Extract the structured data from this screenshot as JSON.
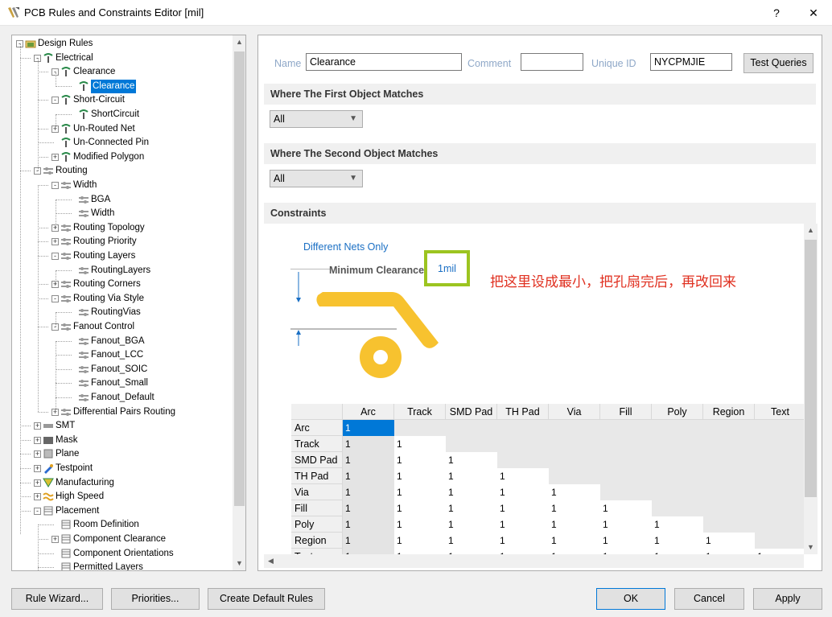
{
  "window": {
    "title": "PCB Rules and Constraints Editor [mil]",
    "help": "?",
    "close": "✕"
  },
  "tree": [
    {
      "label": "Design Rules",
      "depth": 0,
      "exp": "-",
      "icon": "folder"
    },
    {
      "label": "Electrical",
      "depth": 1,
      "exp": "-",
      "icon": "electrical"
    },
    {
      "label": "Clearance",
      "depth": 2,
      "exp": "-",
      "icon": "electrical"
    },
    {
      "label": "Clearance",
      "depth": 3,
      "exp": "",
      "icon": "electrical",
      "selected": true
    },
    {
      "label": "Short-Circuit",
      "depth": 2,
      "exp": "-",
      "icon": "electrical"
    },
    {
      "label": "ShortCircuit",
      "depth": 3,
      "exp": "",
      "icon": "electrical"
    },
    {
      "label": "Un-Routed Net",
      "depth": 2,
      "exp": "+",
      "icon": "electrical"
    },
    {
      "label": "Un-Connected Pin",
      "depth": 2,
      "exp": "",
      "icon": "electrical"
    },
    {
      "label": "Modified Polygon",
      "depth": 2,
      "exp": "+",
      "icon": "electrical"
    },
    {
      "label": "Routing",
      "depth": 1,
      "exp": "-",
      "icon": "routing"
    },
    {
      "label": "Width",
      "depth": 2,
      "exp": "-",
      "icon": "routing"
    },
    {
      "label": "BGA",
      "depth": 3,
      "exp": "",
      "icon": "routing"
    },
    {
      "label": "Width",
      "depth": 3,
      "exp": "",
      "icon": "routing"
    },
    {
      "label": "Routing Topology",
      "depth": 2,
      "exp": "+",
      "icon": "routing"
    },
    {
      "label": "Routing Priority",
      "depth": 2,
      "exp": "+",
      "icon": "routing"
    },
    {
      "label": "Routing Layers",
      "depth": 2,
      "exp": "-",
      "icon": "routing"
    },
    {
      "label": "RoutingLayers",
      "depth": 3,
      "exp": "",
      "icon": "routing"
    },
    {
      "label": "Routing Corners",
      "depth": 2,
      "exp": "+",
      "icon": "routing"
    },
    {
      "label": "Routing Via Style",
      "depth": 2,
      "exp": "-",
      "icon": "routing"
    },
    {
      "label": "RoutingVias",
      "depth": 3,
      "exp": "",
      "icon": "routing"
    },
    {
      "label": "Fanout Control",
      "depth": 2,
      "exp": "-",
      "icon": "routing"
    },
    {
      "label": "Fanout_BGA",
      "depth": 3,
      "exp": "",
      "icon": "routing"
    },
    {
      "label": "Fanout_LCC",
      "depth": 3,
      "exp": "",
      "icon": "routing"
    },
    {
      "label": "Fanout_SOIC",
      "depth": 3,
      "exp": "",
      "icon": "routing"
    },
    {
      "label": "Fanout_Small",
      "depth": 3,
      "exp": "",
      "icon": "routing"
    },
    {
      "label": "Fanout_Default",
      "depth": 3,
      "exp": "",
      "icon": "routing"
    },
    {
      "label": "Differential Pairs Routing",
      "depth": 2,
      "exp": "+",
      "icon": "routing"
    },
    {
      "label": "SMT",
      "depth": 1,
      "exp": "+",
      "icon": "smt"
    },
    {
      "label": "Mask",
      "depth": 1,
      "exp": "+",
      "icon": "mask"
    },
    {
      "label": "Plane",
      "depth": 1,
      "exp": "+",
      "icon": "plane"
    },
    {
      "label": "Testpoint",
      "depth": 1,
      "exp": "+",
      "icon": "testpoint"
    },
    {
      "label": "Manufacturing",
      "depth": 1,
      "exp": "+",
      "icon": "manufacturing"
    },
    {
      "label": "High Speed",
      "depth": 1,
      "exp": "+",
      "icon": "highspeed"
    },
    {
      "label": "Placement",
      "depth": 1,
      "exp": "-",
      "icon": "placement"
    },
    {
      "label": "Room Definition",
      "depth": 2,
      "exp": "",
      "icon": "placement"
    },
    {
      "label": "Component Clearance",
      "depth": 2,
      "exp": "+",
      "icon": "placement"
    },
    {
      "label": "Component Orientations",
      "depth": 2,
      "exp": "",
      "icon": "placement"
    },
    {
      "label": "Permitted Layers",
      "depth": 2,
      "exp": "",
      "icon": "placement"
    }
  ],
  "rule": {
    "name_label": "Name",
    "name_value": "Clearance",
    "comment_label": "Comment",
    "comment_value": "",
    "uid_label": "Unique ID",
    "uid_value": "NYCPMJIE",
    "test_queries": "Test Queries"
  },
  "first_match": {
    "header": "Where The First Object Matches",
    "value": "All"
  },
  "second_match": {
    "header": "Where The Second Object Matches",
    "value": "All"
  },
  "constraints": {
    "header": "Constraints",
    "diff_nets": "Different Nets Only",
    "min_clearance": "Minimum Clearance",
    "value": "1mil",
    "annotation": "把这里设成最小，把孔扇完后，再改回来"
  },
  "matrix": {
    "cols": [
      "Arc",
      "Track",
      "SMD Pad",
      "TH Pad",
      "Via",
      "Fill",
      "Poly",
      "Region",
      "Text"
    ],
    "rows": [
      "Arc",
      "Track",
      "SMD Pad",
      "TH Pad",
      "Via",
      "Fill",
      "Poly",
      "Region",
      "Text"
    ],
    "value": "1"
  },
  "buttons": {
    "rule_wizard": "Rule Wizard...",
    "priorities": "Priorities...",
    "create_default": "Create Default Rules",
    "ok": "OK",
    "cancel": "Cancel",
    "apply": "Apply"
  },
  "colors": {
    "accent": "#0078d7",
    "pad": "#f7c22f",
    "highlight": "#9cc420",
    "annotation": "#e03020",
    "link": "#1a6fc4"
  }
}
